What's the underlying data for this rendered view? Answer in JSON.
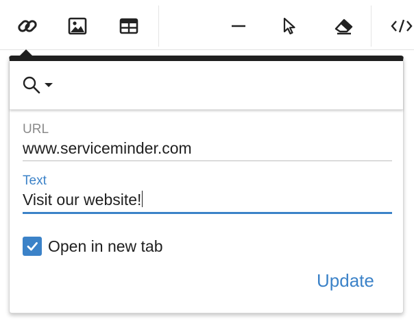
{
  "toolbar": {
    "buttons": [
      {
        "name": "link-button",
        "icon": "link-icon"
      },
      {
        "name": "image-button",
        "icon": "image-icon"
      },
      {
        "name": "table-button",
        "icon": "table-icon"
      },
      {
        "name": "horizontal-rule-button",
        "icon": "horizontal-rule-icon"
      },
      {
        "name": "cursor-button",
        "icon": "cursor-pointer-icon"
      },
      {
        "name": "clear-format-button",
        "icon": "eraser-icon"
      },
      {
        "name": "code-view-button",
        "icon": "code-icon"
      }
    ]
  },
  "link_popover": {
    "search_icon": "search-icon",
    "dropdown_icon": "caret-down-icon",
    "url_label": "URL",
    "url_value": "www.serviceminder.com",
    "text_label": "Text",
    "text_value": "Visit our website!",
    "open_in_new_tab_label": "Open in new tab",
    "open_in_new_tab_checked": true,
    "update_label": "Update"
  },
  "colors": {
    "accent": "#3b82c8",
    "text": "#1f1f1f",
    "label": "#8a8a8a",
    "popover_top_border": "#1f1f1f"
  }
}
